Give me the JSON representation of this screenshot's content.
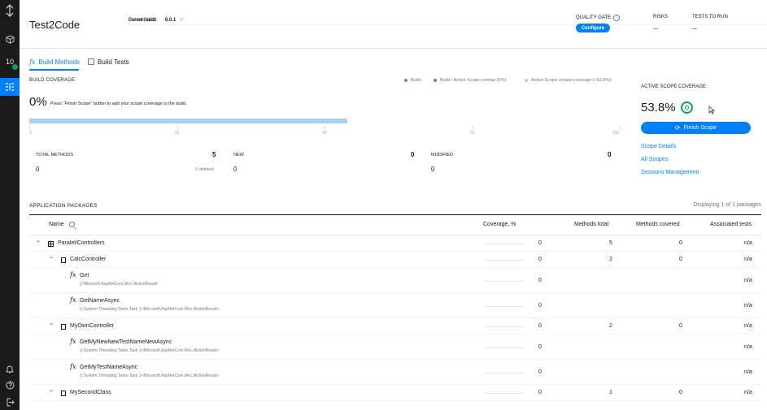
{
  "sidebar": {
    "build_number": "10"
  },
  "header": {
    "title": "Test2Code",
    "current_build_label": "Current build:",
    "current_build_value": "0.0.1",
    "parent_build_label": "Parent build:",
    "parent_build_value": "-",
    "quality_gate_label": "QUALITY GATE",
    "configure_label": "Configure",
    "risks_label": "RISKS",
    "risks_value": "--",
    "tests_to_run_label": "TESTS TO RUN",
    "tests_to_run_value": "--"
  },
  "tabs": [
    {
      "label": "Build Methods",
      "active": true
    },
    {
      "label": "Build Tests",
      "active": false
    }
  ],
  "build_coverage": {
    "title": "BUILD COVERAGE",
    "legend": [
      {
        "label": "Build",
        "color": "#4a90d9"
      },
      {
        "label": "Build / Active Scope overlap (0%)",
        "color": "#5b7fa6"
      },
      {
        "label": "Active Scope unique coverage (+53.8%)",
        "color": "#a8d0f5"
      }
    ],
    "percent": "0%",
    "note": "Press \"Finish Scope\" button to add your scope coverage to the build.",
    "fill_fraction": 0.538,
    "ticks": [
      "0",
      "25",
      "50",
      "75",
      "100"
    ]
  },
  "stats": {
    "total_methods_label": "TOTAL METHODS",
    "total_methods_value": "5",
    "total_methods_sub": "0",
    "deleted": "0 deleted",
    "new_label": "NEW",
    "new_value": "0",
    "new_sub": "0",
    "modified_label": "MODIFIED",
    "modified_value": "0",
    "modified_sub": "0"
  },
  "active_scope": {
    "title": "ACTIVE SCOPE COVERAGE",
    "percent": "53.8%",
    "finish_label": "Finish Scope",
    "links": [
      "Scope Details",
      "All Scopes",
      "Sessions Management"
    ]
  },
  "packages": {
    "title": "APPLICATION PACKAGES",
    "count_text": "Displaying 1 of 1 packages",
    "columns": {
      "name": "Name",
      "coverage": "Coverage, %",
      "methods_total": "Methods total",
      "methods_covered": "Methods covered",
      "associated_tests": "Associated tests"
    },
    "rows": [
      {
        "kind": "package",
        "name": "Paralel/Controllers",
        "coverage": "0",
        "total": "5",
        "covered": "0",
        "tests": "n/a"
      },
      {
        "kind": "class",
        "name": "CalcController",
        "coverage": "0",
        "total": "2",
        "covered": "0",
        "tests": "n/a"
      },
      {
        "kind": "method",
        "name": "Get",
        "desc": "():Microsoft.AspNetCore.Mvc.IActionResult",
        "coverage": "0",
        "tests": "n/a"
      },
      {
        "kind": "method",
        "name": "GetNameAsync",
        "desc": "():System.Threading.Tasks.Task`1<Microsoft.AspNetCore.Mvc.IActionResult>",
        "coverage": "0",
        "tests": "n/a"
      },
      {
        "kind": "class",
        "name": "MyOwnController",
        "coverage": "0",
        "total": "2",
        "covered": "0",
        "tests": "n/a"
      },
      {
        "kind": "method",
        "name": "GetMyNewNewTestNameNewAsync",
        "desc": "():System.Threading.Tasks.Task`1<Microsoft.AspNetCore.Mvc.IActionResult>",
        "coverage": "0",
        "tests": "n/a"
      },
      {
        "kind": "method",
        "name": "GetMyTestNameAsync",
        "desc": "():System.Threading.Tasks.Task`1<Microsoft.AspNetCore.Mvc.IActionResult>",
        "coverage": "0",
        "tests": "n/a"
      },
      {
        "kind": "class",
        "name": "MySecondClass",
        "coverage": "0",
        "total": "1",
        "covered": "0",
        "tests": "n/a"
      }
    ]
  },
  "colors": {
    "accent": "#007fff",
    "success": "#00a854",
    "sidebar": "#1b191b"
  }
}
